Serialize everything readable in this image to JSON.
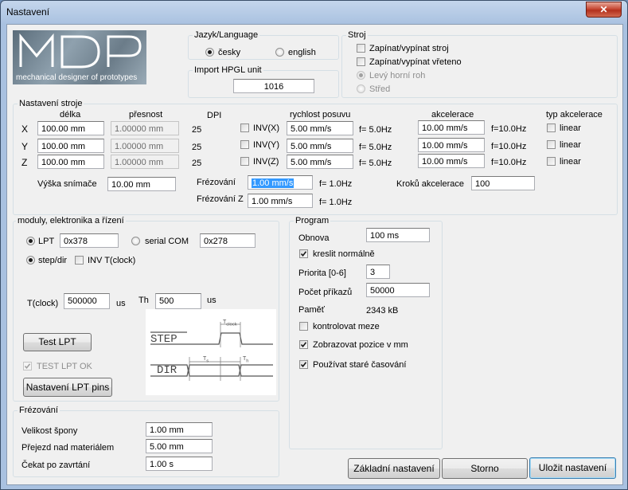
{
  "window": {
    "title": "Nastavení",
    "close_glyph": "✕"
  },
  "logo": {
    "letters": "MDP",
    "tagline": "mechanical designer of prototypes"
  },
  "language": {
    "legend": "Jazyk/Language",
    "czech": "česky",
    "english": "english",
    "selected": "czech"
  },
  "hpgl": {
    "legend": "Import HPGL unit",
    "value": "1016"
  },
  "machine": {
    "legend": "Stroj",
    "toggle_machine": "Zapínat/vypínat stroj",
    "toggle_spindle": "Zapínat/vypínat vřeteno",
    "top_left": "Levý horní roh",
    "center": "Střed"
  },
  "settings": {
    "legend": "Nastavení stroje",
    "col_length": "délka",
    "col_precision": "přesnost",
    "col_dpi": "DPI",
    "col_speed": "rychlost posuvu",
    "col_accel": "akcelerace",
    "col_accel_type": "typ akcelerace",
    "axes": [
      {
        "label": "X",
        "length": "100.00 mm",
        "precision": "1.00000 mm",
        "dpi": "25",
        "inv": "INV(X)",
        "speed": "5.00 mm/s",
        "freq": "f= 5.0Hz",
        "accel": "10.00 mm/s",
        "accel_freq": "f=10.0Hz",
        "accel_type": "linear"
      },
      {
        "label": "Y",
        "length": "100.00 mm",
        "precision": "1.00000 mm",
        "dpi": "25",
        "inv": "INV(Y)",
        "speed": "5.00 mm/s",
        "freq": "f= 5.0Hz",
        "accel": "10.00 mm/s",
        "accel_freq": "f=10.0Hz",
        "accel_type": "linear"
      },
      {
        "label": "Z",
        "length": "100.00 mm",
        "precision": "1.00000 mm",
        "dpi": "25",
        "inv": "INV(Z)",
        "speed": "5.00 mm/s",
        "freq": "f= 5.0Hz",
        "accel": "10.00 mm/s",
        "accel_freq": "f=10.0Hz",
        "accel_type": "linear"
      }
    ],
    "sensor_height_label": "Výška snímače",
    "sensor_height": "10.00 mm",
    "milling_label": "Frézování",
    "milling_speed": "1.00 mm/s",
    "milling_freq": "f= 1.0Hz",
    "milling_z_label": "Frézování Z",
    "milling_z_speed": "1.00 mm/s",
    "milling_z_freq": "f= 1.0Hz",
    "accel_steps_label": "Kroků akcelerace",
    "accel_steps": "100"
  },
  "modules": {
    "legend": "moduly, elektronika a řízení",
    "lpt_label": "LPT",
    "lpt_addr": "0x378",
    "serial_label": "serial COM",
    "serial_addr": "0x278",
    "stepdir_label": "step/dir",
    "inv_clock_label": "INV T(clock)",
    "tclock_label": "T(clock)",
    "tclock": "500000",
    "tclock_unit": "us",
    "th_label": "Th",
    "th": "500",
    "th_unit": "us",
    "test_lpt": "Test LPT",
    "test_lpt_ok": "TEST LPT OK",
    "lpt_pins": "Nastavení LPT pins"
  },
  "timing_diagram": {
    "step": "STEP",
    "dir": "DIR",
    "tclock": "T",
    "tclock_sub": "clock",
    "ts": "T",
    "ts_sub": "s",
    "th": "T",
    "th_sub": "h"
  },
  "milling": {
    "legend": "Frézování",
    "chip_size_label": "Velikost špony",
    "chip_size": "1.00 mm",
    "over_material_label": "Přejezd nad materiálem",
    "over_material": "5.00 mm",
    "wait_label": "Čekat po zavrtání",
    "wait": "1.00 s"
  },
  "program": {
    "legend": "Program",
    "refresh_label": "Obnova",
    "refresh": "100 ms",
    "draw_normal": "kreslit normálně",
    "priority_label": "Priorita [0-6]",
    "priority": "3",
    "commands_label": "Počet příkazů",
    "commands": "50000",
    "memory_label": "Paměť",
    "memory": "2343 kB",
    "check_limits": "kontrolovat meze",
    "show_pos_mm": "Zobrazovat pozice v mm",
    "old_timing": "Používat staré časování"
  },
  "buttons": {
    "defaults": "Základní nastavení",
    "cancel": "Storno",
    "save": "Uložit nastavení"
  }
}
